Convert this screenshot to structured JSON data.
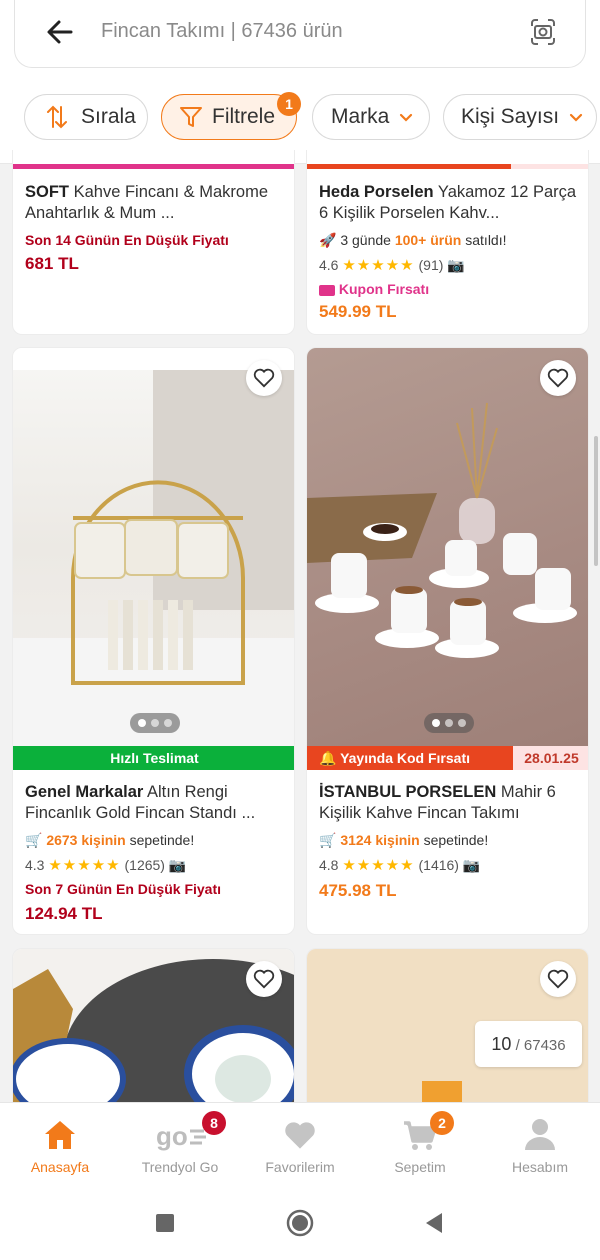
{
  "search": {
    "text": "Fincan Takımı | 67436 ürün"
  },
  "filters": {
    "sort_label": "Sırala",
    "filter_label": "Filtrele",
    "filter_badge": "1",
    "brand_label": "Marka",
    "persons_label": "Kişi Sayısı"
  },
  "products": [
    {
      "brand": "SOFT",
      "name": " Kahve Fincanı & Makrome Anahtarlık & Mum ...",
      "note": "Son 14 Günün En Düşük Fiyatı",
      "price": "681 TL"
    },
    {
      "brand": "Heda Porselen",
      "name": " Yakamoz 12 Parça 6 Kişilik Porselen Kahv...",
      "sold_prefix": "3 günde ",
      "sold_count": "100+ ürün",
      "sold_suffix": " satıldı!",
      "rating": "4.6",
      "stars": "★★★★★",
      "reviews": "(91)",
      "coupon": "Kupon Fırsatı",
      "price": "549.99 TL"
    },
    {
      "brand": "Genel Markalar",
      "name": " Altın Rengi Fincanlık Gold Fincan Standı ...",
      "tag": "Hızlı Teslimat",
      "basket_count": "2673 kişinin",
      "basket_suffix": " sepetinde!",
      "rating": "4.3",
      "stars": "★★★★★",
      "reviews": "(1265)",
      "note": "Son 7 Günün En Düşük Fiyatı",
      "price": "124.94 TL"
    },
    {
      "brand": "İSTANBUL PORSELEN",
      "name": " Mahir 6 Kişilik Kahve Fincan Takımı",
      "tag": "Yayında Kod Fırsatı",
      "tag_date": "28.01.25",
      "basket_count": "3124 kişinin",
      "basket_suffix": " sepetinde!",
      "rating": "4.8",
      "stars": "★★★★★",
      "reviews": "(1416)",
      "price": "475.98 TL"
    }
  ],
  "counter": {
    "current": "10",
    "total": " / 67436"
  },
  "nav": [
    {
      "label": "Anasayfa"
    },
    {
      "label": "Trendyol Go",
      "badge": "8"
    },
    {
      "label": "Favorilerim"
    },
    {
      "label": "Sepetim",
      "badge": "2"
    },
    {
      "label": "Hesabım"
    }
  ],
  "colors": {
    "accent": "#f27a1a",
    "red_price": "#b1001b",
    "green_tag": "#0bb03b",
    "pink": "#e0338a"
  }
}
